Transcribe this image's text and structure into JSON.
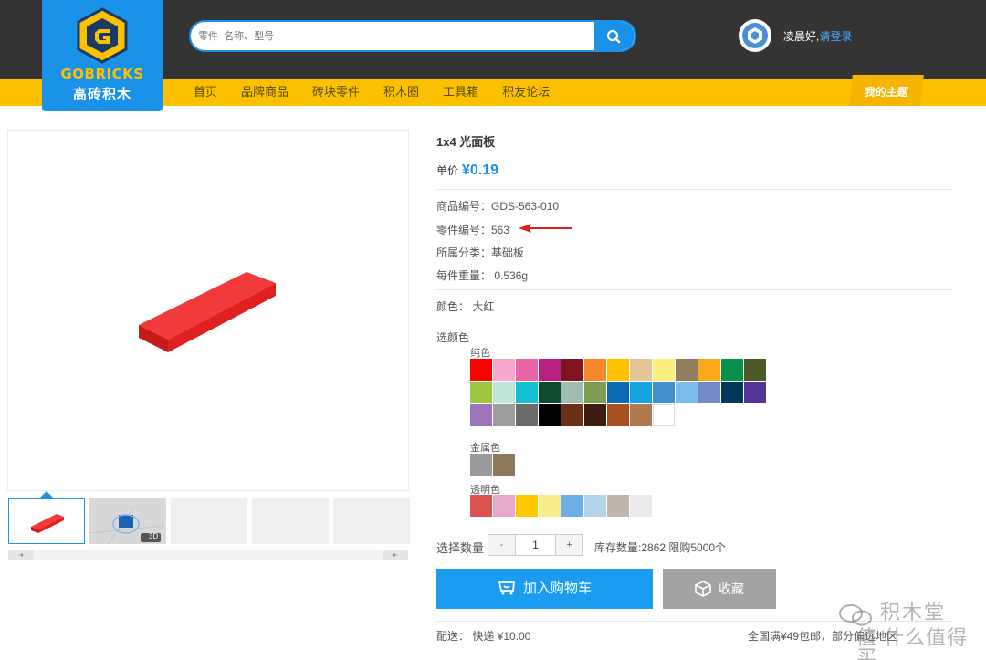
{
  "logo": {
    "brand_en": "GOBRICKS",
    "brand_cn": "高砖积木"
  },
  "search": {
    "placeholder": "零件  名称、型号"
  },
  "user": {
    "greeting": "凌晨好,",
    "login": "请登录"
  },
  "nav": {
    "items": [
      "首页",
      "品牌商品",
      "砖块零件",
      "积木圈",
      "工具箱",
      "积友论坛"
    ],
    "my_theme": "我的主题"
  },
  "product": {
    "title": "1x4 光面板",
    "price_label": "单价",
    "price": "¥0.19",
    "product_code": "商品编号：GDS-563-010",
    "part_number": "零件编号：563",
    "category": "所属分类：基础板",
    "weight": "每件重量： 0.536g",
    "color": "颜色： 大红",
    "image_color": "#e8232a"
  },
  "color_picker": {
    "label": "选颜色",
    "groups": [
      {
        "name": "纯色",
        "swatches": [
          "#ff0000",
          "#f7a8cc",
          "#e865a8",
          "#b81f7e",
          "#7e1420",
          "#f6872a",
          "#ffc200",
          "#e4c698",
          "#f9f07c",
          "#8f7e5e",
          "#f9a81a",
          "#07914a",
          "#4c5a28",
          "#9dc73d",
          "#bfe6db",
          "#13bfd3",
          "#0d4a2e",
          "#a1bdad",
          "#7e9c50",
          "#0a6bb3",
          "#16a4e0",
          "#4191cf",
          "#7abde9",
          "#7589c5",
          "#03385b",
          "#533496",
          "#9b74bb",
          "#9d9d9d",
          "#6a6a6a",
          "#000000",
          "#6b3117",
          "#3d1d10",
          "#a8501e",
          "#b07a4e",
          "#ffffff"
        ]
      },
      {
        "name": "金属色",
        "swatches": [
          "#9a9a9a",
          "#8c7a5a"
        ]
      },
      {
        "name": "透明色",
        "swatches": [
          "#d9534f",
          "#e8a9c9",
          "#ffc700",
          "#f8ef8c",
          "#6faee7",
          "#b3d4ea",
          "#c0b6ad",
          "#e9eaea"
        ]
      }
    ]
  },
  "quantity": {
    "label": "选择数量",
    "minus": "-",
    "value": "1",
    "plus": "+",
    "stock": "库存数量:2862   限购5000个"
  },
  "actions": {
    "add_to_cart": "加入购物车",
    "favorite": "收藏"
  },
  "shipping": {
    "text": "配送：  快递    ¥10.00",
    "free": "全国满¥49包邮，部分偏远地区"
  },
  "watermark": {
    "line1": "积木堂",
    "line2": "值 什么值得买"
  },
  "thumbnails": {
    "badge_3d": "3D"
  },
  "scroll": {
    "left": "◂",
    "right": "▸"
  }
}
